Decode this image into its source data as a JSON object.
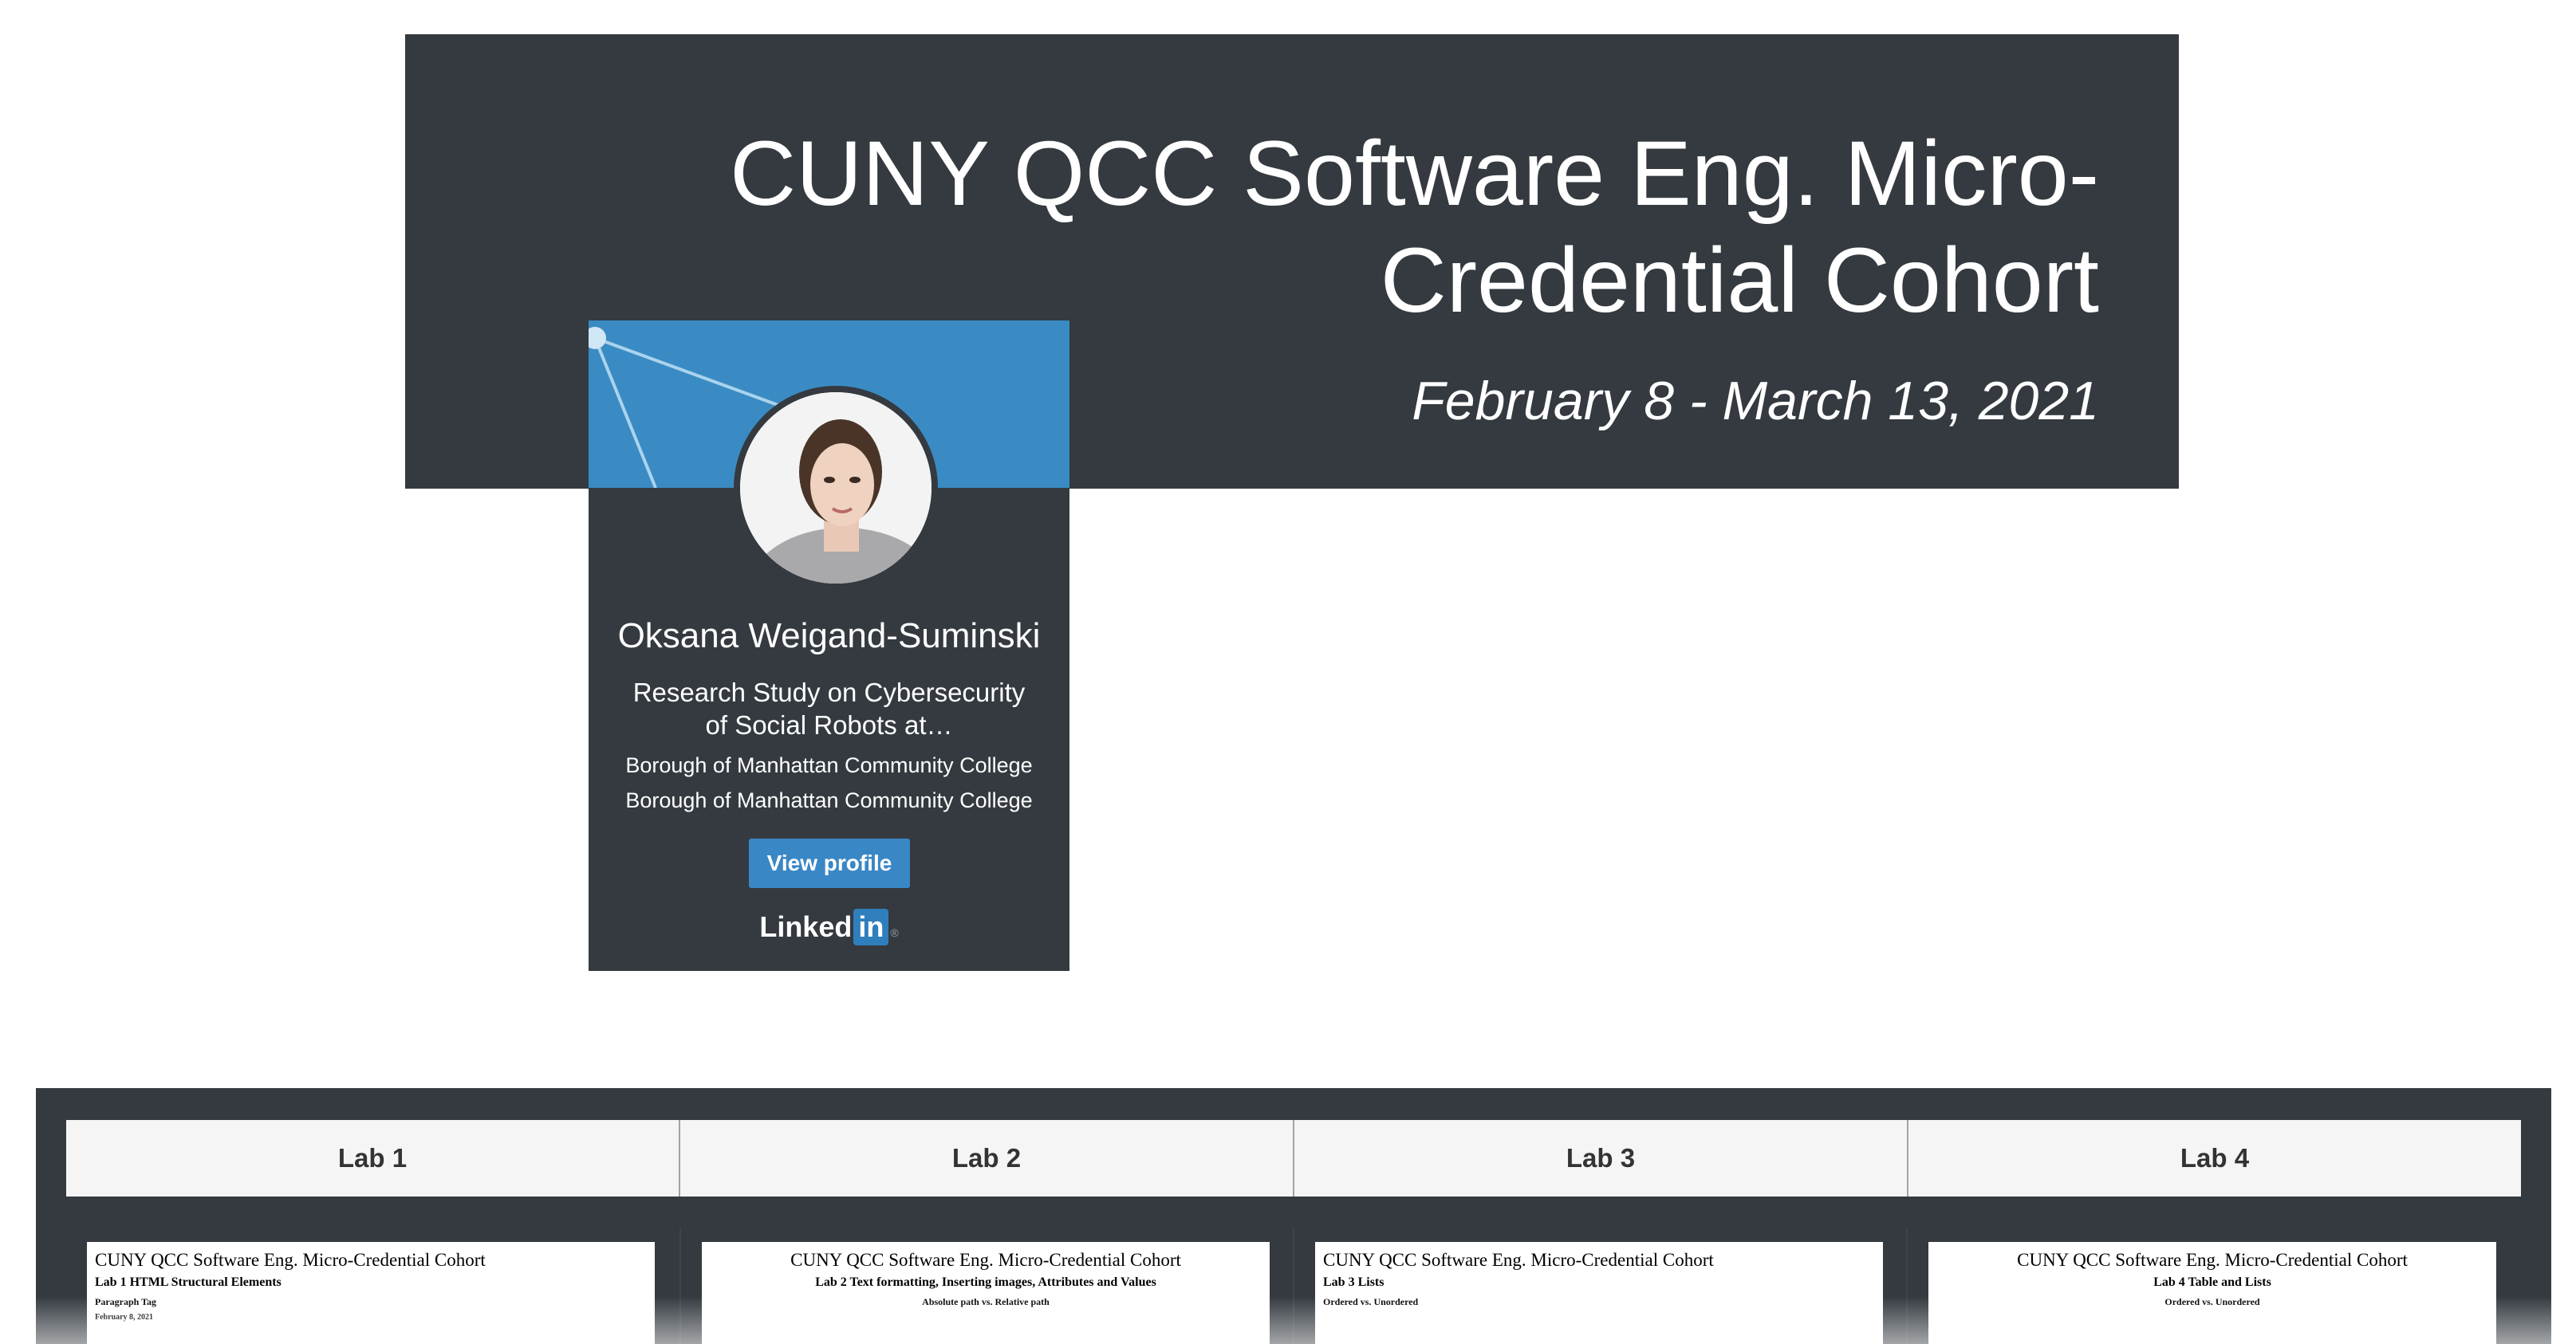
{
  "header": {
    "title": "CUNY QCC Software Eng. Micro-Credential Cohort",
    "dates": "February 8 - March 13, 2021"
  },
  "profile": {
    "name": "Oksana Weigand-Suminski",
    "headline": "Research Study on Cybersecurity of Social Robots at…",
    "org1": "Borough of Manhattan Community College",
    "org2": "Borough of Manhattan Community College",
    "view_label": "View profile",
    "linkedin_word": "Linked",
    "linkedin_in": "in",
    "linkedin_reg": "®",
    "banner_color": "#3a8bc3",
    "button_color": "#3a87c6"
  },
  "labs": {
    "tabs": [
      {
        "label": "Lab 1"
      },
      {
        "label": "Lab 2"
      },
      {
        "label": "Lab 3"
      },
      {
        "label": "Lab 4"
      }
    ],
    "docs": [
      {
        "title": "CUNY QCC Software Eng. Micro-Credential Cohort",
        "subtitle": "Lab 1 HTML Structural Elements",
        "note": "Paragraph Tag",
        "date": "February 8, 2021"
      },
      {
        "title": "CUNY QCC Software Eng. Micro-Credential Cohort",
        "subtitle": "Lab 2 Text formatting, Inserting images, Attributes and Values",
        "note": "Absolute path vs. Relative path"
      },
      {
        "title": "CUNY QCC Software Eng. Micro-Credential Cohort",
        "subtitle": "Lab 3 Lists",
        "note": "Ordered vs. Unordered"
      },
      {
        "title": "CUNY QCC Software Eng. Micro-Credential Cohort",
        "subtitle": "Lab 4 Table and Lists",
        "note": "Ordered vs. Unordered"
      }
    ]
  },
  "colors": {
    "dark_panel": "#343a40",
    "tab_background": "#f5f5f5"
  }
}
